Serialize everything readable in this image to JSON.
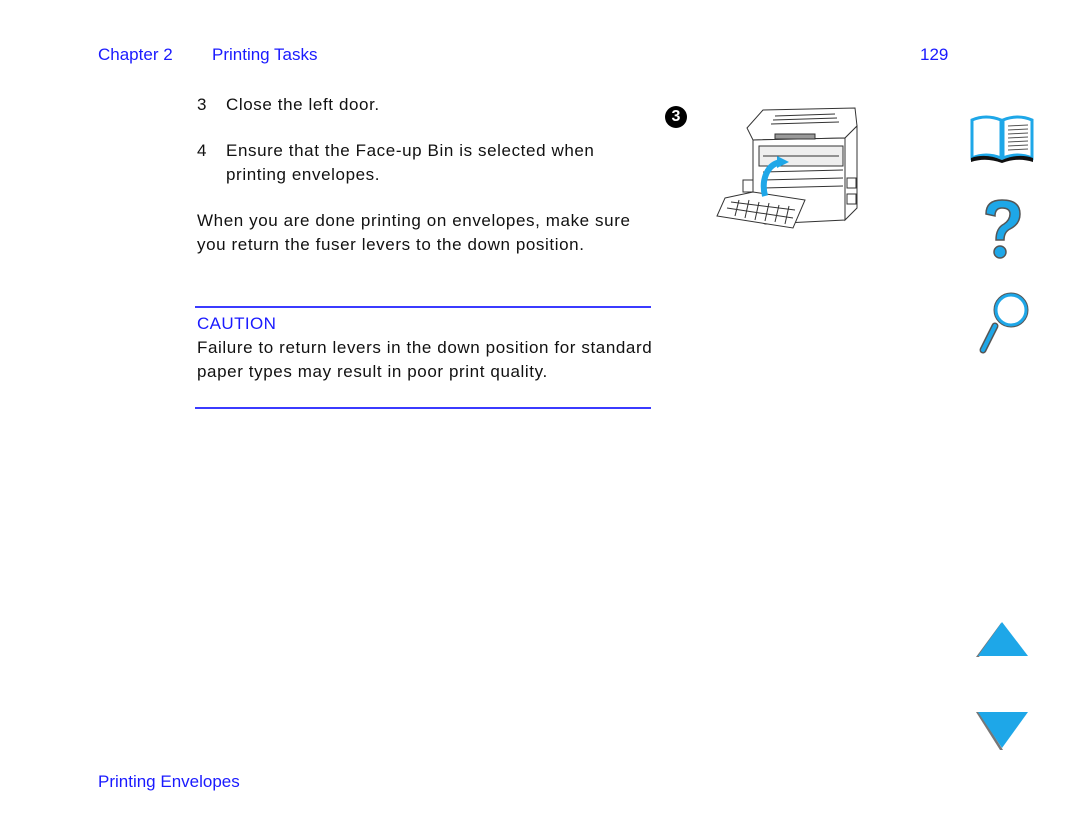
{
  "header": {
    "chapter": "Chapter 2",
    "section": "Printing Tasks",
    "page_number": "129"
  },
  "steps": [
    {
      "number": "3",
      "text": "Close the left door."
    },
    {
      "number": "4",
      "text": "Ensure that the Face-up Bin is selected when printing envelopes."
    }
  ],
  "paragraph": "When you are done printing on envelopes, make sure you return the fuser levers to the down position.",
  "caution": {
    "title": "CAUTION",
    "text": "Failure to return levers in the down position for standard paper types may result in poor print quality."
  },
  "figure": {
    "step_badge": "3",
    "description": "printer-left-door-closing-illustration"
  },
  "nav_icons": {
    "contents": "book-icon",
    "help": "question-mark-icon",
    "index": "magnifier-icon",
    "previous": "triangle-up-icon",
    "next": "triangle-down-icon"
  },
  "footer": {
    "link": "Printing Envelopes"
  },
  "colors": {
    "link_blue": "#1a1aff",
    "rule_blue": "#3b3bff",
    "icon_cyan": "#1ea7e8"
  }
}
